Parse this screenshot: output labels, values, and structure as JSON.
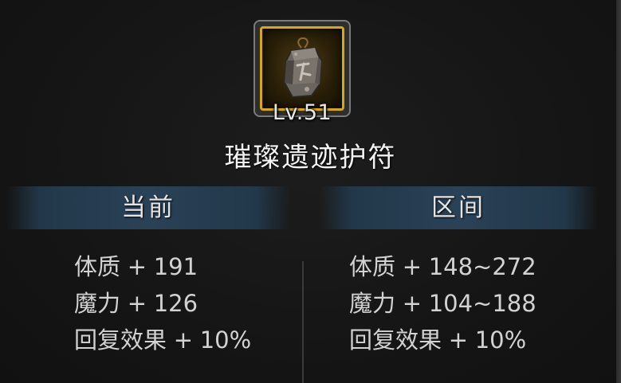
{
  "item": {
    "level": "Lv.51",
    "name": "璀璨遗迹护符",
    "icon": "amulet-icon",
    "frame_color": "#d8a813"
  },
  "columns": {
    "current": {
      "header": "当前",
      "stats": [
        {
          "name": "体质",
          "sign": "+",
          "value": "191"
        },
        {
          "name": "魔力",
          "sign": "+",
          "value": "126"
        },
        {
          "name": "回复效果",
          "sign": "+",
          "value": "10%"
        }
      ]
    },
    "range": {
      "header": "区间",
      "stats": [
        {
          "name": "体质",
          "sign": "+",
          "value": "148~272"
        },
        {
          "name": "魔力",
          "sign": "+",
          "value": "104~188"
        },
        {
          "name": "回复效果",
          "sign": "+",
          "value": "10%"
        }
      ]
    }
  },
  "colors": {
    "header_band": "#2a4257",
    "background": "#151515",
    "text": "#d2d2d2"
  }
}
